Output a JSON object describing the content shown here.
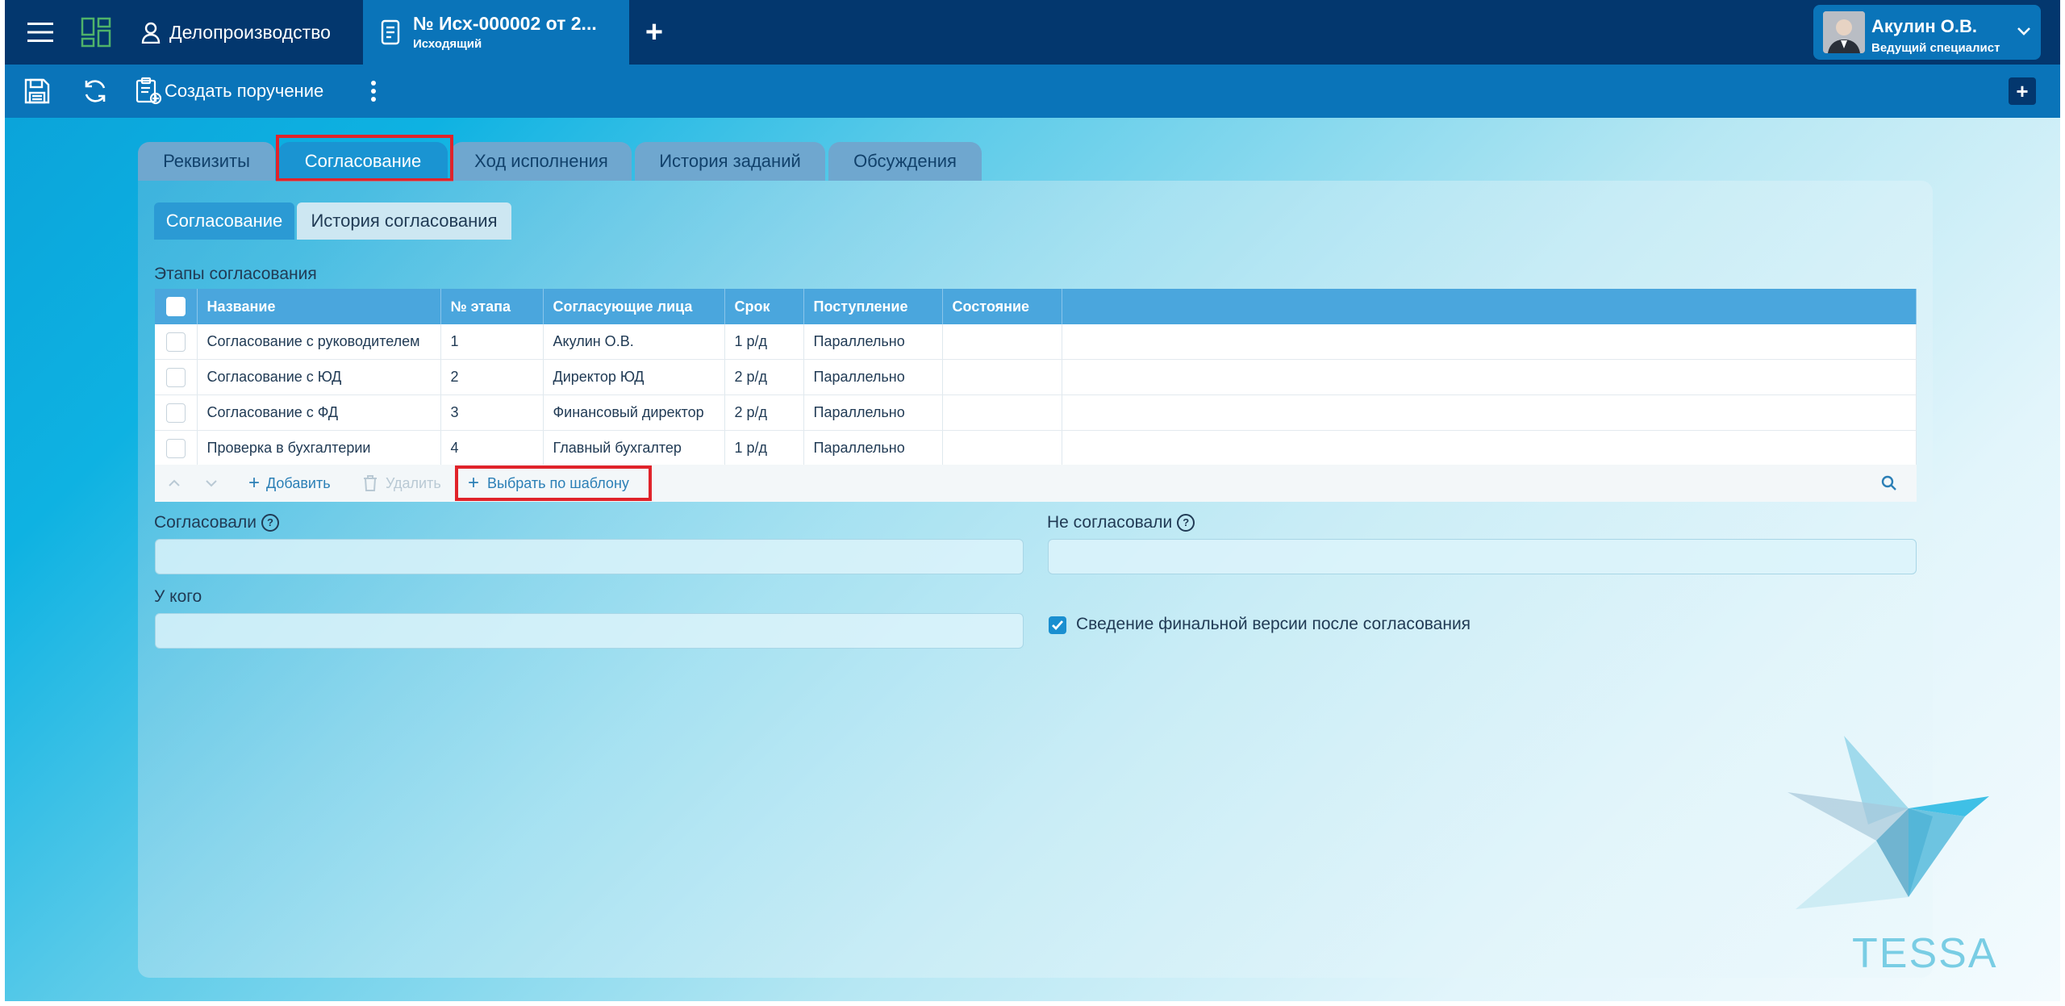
{
  "topbar": {
    "app_section": "Делопроизводство",
    "doc_tab": {
      "title": "№ Исх-000002 от 2...",
      "subtitle": "Исходящий"
    },
    "add_tab_symbol": "+",
    "user": {
      "name": "Акулин О.В.",
      "role": "Ведущий специалист"
    }
  },
  "toolbar": {
    "create_task_label": "Создать поручение",
    "add_symbol": "+"
  },
  "main_tabs": [
    {
      "label": "Реквизиты"
    },
    {
      "label": "Согласование"
    },
    {
      "label": "Ход исполнения"
    },
    {
      "label": "История заданий"
    },
    {
      "label": "Обсуждения"
    }
  ],
  "sub_tabs": [
    {
      "label": "Согласование"
    },
    {
      "label": "История согласования"
    }
  ],
  "stages": {
    "title": "Этапы согласования",
    "columns": [
      "Название",
      "№ этапа",
      "Согласующие лица",
      "Срок",
      "Поступление",
      "Состояние"
    ],
    "rows": [
      {
        "name": "Согласование с руководителем",
        "num": "1",
        "approvers": "Акулин О.В.",
        "term": "1 р/д",
        "arrival": "Параллельно",
        "state": ""
      },
      {
        "name": "Согласование с ЮД",
        "num": "2",
        "approvers": "Директор ЮД",
        "term": "2 р/д",
        "arrival": "Параллельно",
        "state": ""
      },
      {
        "name": "Согласование с ФД",
        "num": "3",
        "approvers": "Финансовый директор",
        "term": "2 р/д",
        "arrival": "Параллельно",
        "state": ""
      },
      {
        "name": "Проверка в бухгалтерии",
        "num": "4",
        "approvers": "Главный бухгалтер",
        "term": "1 р/д",
        "arrival": "Параллельно",
        "state": ""
      }
    ],
    "actions": {
      "add": "Добавить",
      "delete": "Удалить",
      "by_template": "Выбрать по шаблону"
    }
  },
  "fields": {
    "approved_label": "Согласовали",
    "not_approved_label": "Не согласовали",
    "at_whom_label": "У кого",
    "final_version_label": "Сведение финальной версии после согласования",
    "final_version_checked": true,
    "help_symbol": "?"
  },
  "logo_text": "TESSA"
}
